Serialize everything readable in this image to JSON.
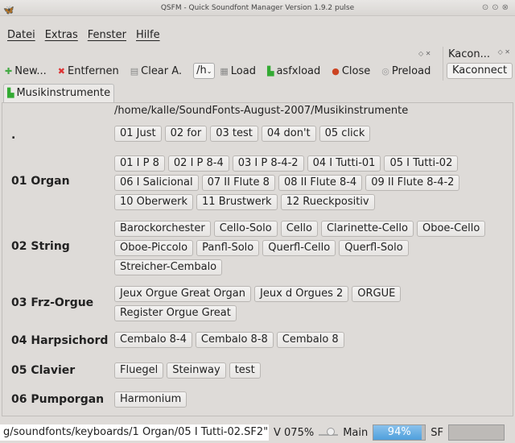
{
  "window": {
    "title": "QSFM - Quick Soundfont Manager Version 1.9.2 pulse"
  },
  "menu": [
    "Datei",
    "Extras",
    "Fenster",
    "Hilfe"
  ],
  "toolbar": {
    "new": "New...",
    "remove": "Entfernen",
    "clear": "Clear A.",
    "combo": "/h",
    "load": "Load",
    "asfxload": "asfxload",
    "close": "Close",
    "preload": "Preload"
  },
  "kacon": {
    "title": "Kacon...",
    "button": "Kaconnect"
  },
  "tab": "Musikinstrumente",
  "path": "/home/kalle/SoundFonts-August-2007/Musikinstrumente",
  "groups": [
    {
      "label": ".",
      "items": [
        "01 Just",
        "02 for",
        "03 test",
        "04 don't",
        "05 click"
      ]
    },
    {
      "label": "01 Organ",
      "items": [
        "01 I P 8",
        "02 I P 8-4",
        "03 I P 8-4-2",
        "04 I Tutti-01",
        "05 I Tutti-02",
        "06 I Salicional",
        "07 II Flute 8",
        "08 II Flute 8-4",
        "09 II Flute 8-4-2",
        "10 Oberwerk",
        "11 Brustwerk",
        "12 Rueckpositiv"
      ]
    },
    {
      "label": "02 String",
      "items": [
        "Barockorchester",
        "Cello-Solo",
        "Cello",
        "Clarinette-Cello",
        "Oboe-Cello",
        "Oboe-Piccolo",
        "Panfl-Solo",
        "Querfl-Cello",
        "Querfl-Solo",
        "Streicher-Cembalo"
      ]
    },
    {
      "label": "03 Frz-Orgue",
      "items": [
        "Jeux Orgue Great Organ",
        "Jeux d Orgues 2",
        "ORGUE",
        "Register Orgue Great"
      ]
    },
    {
      "label": "04 Harpsichord",
      "items": [
        "Cembalo 8-4",
        "Cembalo 8-8",
        "Cembalo 8"
      ]
    },
    {
      "label": "05 Clavier",
      "items": [
        "Fluegel",
        "Steinway",
        "test"
      ]
    },
    {
      "label": "06 Pumporgan",
      "items": [
        "Harmonium"
      ]
    }
  ],
  "status": {
    "soundfont": "g/soundfonts/keyboards/1 Organ/05 I Tutti-02.SF2\"",
    "volume": "V 075%",
    "main_label": "Main",
    "main_value": "94%",
    "main_fraction": 0.94,
    "sf_label": "SF",
    "sf_fraction": 0
  }
}
